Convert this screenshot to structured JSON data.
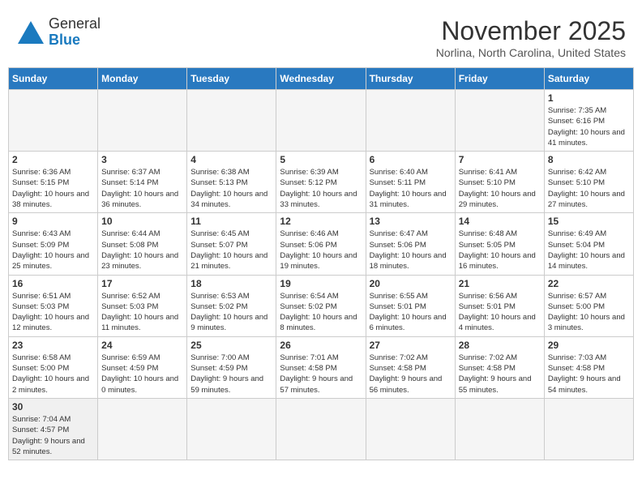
{
  "logo": {
    "line1": "General",
    "line2": "Blue"
  },
  "title": "November 2025",
  "location": "Norlina, North Carolina, United States",
  "weekdays": [
    "Sunday",
    "Monday",
    "Tuesday",
    "Wednesday",
    "Thursday",
    "Friday",
    "Saturday"
  ],
  "weeks": [
    [
      {
        "day": "",
        "empty": true
      },
      {
        "day": "",
        "empty": true
      },
      {
        "day": "",
        "empty": true
      },
      {
        "day": "",
        "empty": true
      },
      {
        "day": "",
        "empty": true
      },
      {
        "day": "",
        "empty": true
      },
      {
        "day": "1",
        "sunrise": "7:35 AM",
        "sunset": "6:16 PM",
        "daylight": "10 hours and 41 minutes."
      }
    ],
    [
      {
        "day": "2",
        "sunrise": "6:36 AM",
        "sunset": "5:15 PM",
        "daylight": "10 hours and 38 minutes."
      },
      {
        "day": "3",
        "sunrise": "6:37 AM",
        "sunset": "5:14 PM",
        "daylight": "10 hours and 36 minutes."
      },
      {
        "day": "4",
        "sunrise": "6:38 AM",
        "sunset": "5:13 PM",
        "daylight": "10 hours and 34 minutes."
      },
      {
        "day": "5",
        "sunrise": "6:39 AM",
        "sunset": "5:12 PM",
        "daylight": "10 hours and 33 minutes."
      },
      {
        "day": "6",
        "sunrise": "6:40 AM",
        "sunset": "5:11 PM",
        "daylight": "10 hours and 31 minutes."
      },
      {
        "day": "7",
        "sunrise": "6:41 AM",
        "sunset": "5:10 PM",
        "daylight": "10 hours and 29 minutes."
      },
      {
        "day": "8",
        "sunrise": "6:42 AM",
        "sunset": "5:10 PM",
        "daylight": "10 hours and 27 minutes."
      }
    ],
    [
      {
        "day": "9",
        "sunrise": "6:43 AM",
        "sunset": "5:09 PM",
        "daylight": "10 hours and 25 minutes."
      },
      {
        "day": "10",
        "sunrise": "6:44 AM",
        "sunset": "5:08 PM",
        "daylight": "10 hours and 23 minutes."
      },
      {
        "day": "11",
        "sunrise": "6:45 AM",
        "sunset": "5:07 PM",
        "daylight": "10 hours and 21 minutes."
      },
      {
        "day": "12",
        "sunrise": "6:46 AM",
        "sunset": "5:06 PM",
        "daylight": "10 hours and 19 minutes."
      },
      {
        "day": "13",
        "sunrise": "6:47 AM",
        "sunset": "5:06 PM",
        "daylight": "10 hours and 18 minutes."
      },
      {
        "day": "14",
        "sunrise": "6:48 AM",
        "sunset": "5:05 PM",
        "daylight": "10 hours and 16 minutes."
      },
      {
        "day": "15",
        "sunrise": "6:49 AM",
        "sunset": "5:04 PM",
        "daylight": "10 hours and 14 minutes."
      }
    ],
    [
      {
        "day": "16",
        "sunrise": "6:51 AM",
        "sunset": "5:03 PM",
        "daylight": "10 hours and 12 minutes."
      },
      {
        "day": "17",
        "sunrise": "6:52 AM",
        "sunset": "5:03 PM",
        "daylight": "10 hours and 11 minutes."
      },
      {
        "day": "18",
        "sunrise": "6:53 AM",
        "sunset": "5:02 PM",
        "daylight": "10 hours and 9 minutes."
      },
      {
        "day": "19",
        "sunrise": "6:54 AM",
        "sunset": "5:02 PM",
        "daylight": "10 hours and 8 minutes."
      },
      {
        "day": "20",
        "sunrise": "6:55 AM",
        "sunset": "5:01 PM",
        "daylight": "10 hours and 6 minutes."
      },
      {
        "day": "21",
        "sunrise": "6:56 AM",
        "sunset": "5:01 PM",
        "daylight": "10 hours and 4 minutes."
      },
      {
        "day": "22",
        "sunrise": "6:57 AM",
        "sunset": "5:00 PM",
        "daylight": "10 hours and 3 minutes."
      }
    ],
    [
      {
        "day": "23",
        "sunrise": "6:58 AM",
        "sunset": "5:00 PM",
        "daylight": "10 hours and 2 minutes."
      },
      {
        "day": "24",
        "sunrise": "6:59 AM",
        "sunset": "4:59 PM",
        "daylight": "10 hours and 0 minutes."
      },
      {
        "day": "25",
        "sunrise": "7:00 AM",
        "sunset": "4:59 PM",
        "daylight": "9 hours and 59 minutes."
      },
      {
        "day": "26",
        "sunrise": "7:01 AM",
        "sunset": "4:58 PM",
        "daylight": "9 hours and 57 minutes."
      },
      {
        "day": "27",
        "sunrise": "7:02 AM",
        "sunset": "4:58 PM",
        "daylight": "9 hours and 56 minutes."
      },
      {
        "day": "28",
        "sunrise": "7:02 AM",
        "sunset": "4:58 PM",
        "daylight": "9 hours and 55 minutes."
      },
      {
        "day": "29",
        "sunrise": "7:03 AM",
        "sunset": "4:58 PM",
        "daylight": "9 hours and 54 minutes."
      }
    ],
    [
      {
        "day": "30",
        "sunrise": "7:04 AM",
        "sunset": "4:57 PM",
        "daylight": "9 hours and 52 minutes."
      },
      {
        "day": "",
        "empty": true
      },
      {
        "day": "",
        "empty": true
      },
      {
        "day": "",
        "empty": true
      },
      {
        "day": "",
        "empty": true
      },
      {
        "day": "",
        "empty": true
      },
      {
        "day": "",
        "empty": true
      }
    ]
  ]
}
